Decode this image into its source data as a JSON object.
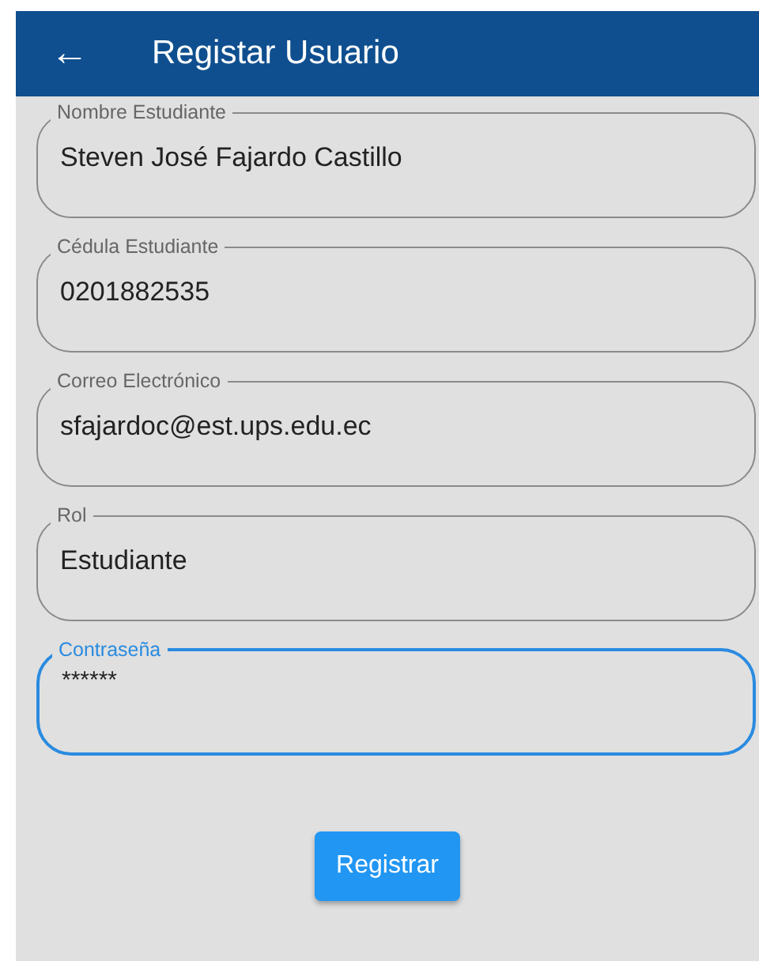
{
  "app_bar": {
    "back_icon": "←",
    "title": "Registar Usuario"
  },
  "fields": [
    {
      "label": "Nombre Estudiante",
      "value": "Steven José Fajardo Castillo",
      "focused": false
    },
    {
      "label": "Cédula Estudiante",
      "value": "0201882535",
      "focused": false
    },
    {
      "label": "Correo Electrónico",
      "value": "sfajardoc@est.ups.edu.ec",
      "focused": false
    },
    {
      "label": "Rol",
      "value": "Estudiante",
      "focused": false
    },
    {
      "label": "Contraseña",
      "value": "******",
      "focused": true
    }
  ],
  "submit_button": "Registrar"
}
